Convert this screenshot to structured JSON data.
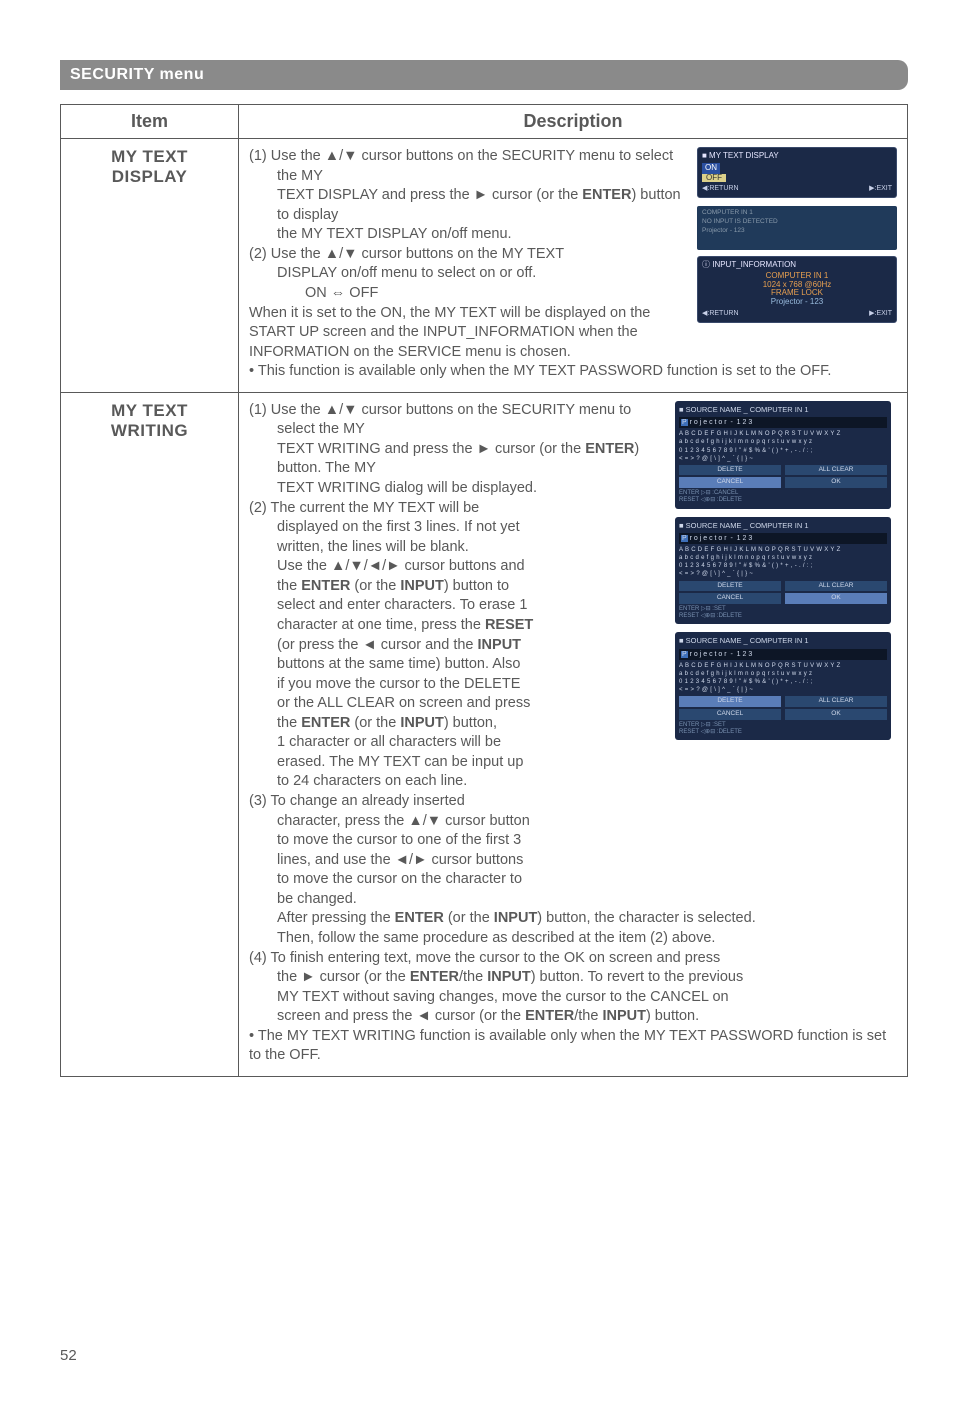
{
  "page_number": "52",
  "menu_header": "SECURITY menu",
  "table": {
    "headers": {
      "item": "Item",
      "description": "Description"
    },
    "rows": [
      {
        "item_line1": "MY TEXT",
        "item_line2": "DISPLAY",
        "desc": {
          "p1a": "(1) Use the ▲/▼ cursor buttons on the SECURITY menu to select the MY",
          "p1b": "TEXT DISPLAY and press the ► cursor (or the ",
          "p1b_bold": "ENTER",
          "p1c": ") button to display",
          "p1d": "the MY TEXT DISPLAY on/off menu.",
          "p2a": "(2) Use the ▲/▼ cursor buttons on the MY TEXT",
          "p2b": "DISPLAY on/off menu to select on or off.",
          "toggle": "ON ⇔ OFF",
          "p3": "When it is set to the ON, the MY TEXT will be displayed on the START UP screen and the INPUT_INFORMATION when the INFORMATION on the SERVICE menu is chosen.",
          "note1": "• This function is available only when the MY TEXT PASSWORD function is set to the OFF.",
          "osd1": {
            "title": "■ MY TEXT DISPLAY",
            "on": "ON",
            "off": "OFF",
            "ret": "◀:RETURN",
            "exit": "▶:EXIT"
          },
          "osd2": {
            "l1": "COMPUTER IN 1",
            "l2": "NO INPUT IS DETECTED",
            "l3": "Projector - 123"
          },
          "osd3": {
            "title": "ⓘ INPUT_INFORMATION",
            "l1": "COMPUTER IN 1",
            "l2": "1024 x 768 @60Hz",
            "l3": "FRAME LOCK",
            "l4": "Projector - 123",
            "ret": "◀:RETURN",
            "exit": "▶:EXIT"
          }
        }
      },
      {
        "item_line1": "MY TEXT",
        "item_line2": "WRITING",
        "desc": {
          "p1a": "(1) Use the ▲/▼ cursor buttons on the SECURITY menu to select the MY",
          "p1b": "TEXT WRITING and press the ► cursor (or the ",
          "p1b_bold": "ENTER",
          "p1c": ") button. The MY",
          "p1d": "TEXT WRITING dialog will be displayed.",
          "p2a": "(2) The current the MY TEXT will be",
          "p2b": "displayed on the first 3 lines. If not yet",
          "p2c": "written, the lines will be blank.",
          "p2d": "Use the ▲/▼/◄/► cursor buttons and",
          "p2e_a": "the ",
          "p2e_b1": "ENTER",
          "p2e_c": " (or the ",
          "p2e_b2": "INPUT",
          "p2e_d": ") button to",
          "p2f": "select and enter characters. To erase 1",
          "p2g_a": "character at one time, press the ",
          "p2g_b": "RESET",
          "p2h_a": "(or press the ◄ cursor and the ",
          "p2h_b": "INPUT",
          "p2i": "buttons at the same time) button. Also",
          "p2j": "if you move the cursor to the DELETE",
          "p2k": "or the ALL CLEAR on screen and press",
          "p2l_a": "the ",
          "p2l_b1": "ENTER",
          "p2l_c": " (or the ",
          "p2l_b2": "INPUT",
          "p2l_d": ") button,",
          "p2m": "1 character or all characters will be",
          "p2n": "erased. The MY TEXT can be input up",
          "p2o": "to 24 characters on each line.",
          "p3a": "(3) To change an already inserted",
          "p3b": "character, press the ▲/▼ cursor button",
          "p3c": "to move the cursor to one of the first 3",
          "p3d": "lines, and use the ◄/► cursor buttons",
          "p3e": "to move the cursor on the character to",
          "p3f": "be changed.",
          "p3g_a": "After pressing the ",
          "p3g_b1": "ENTER",
          "p3g_c": " (or the ",
          "p3g_b2": "INPUT",
          "p3g_d": ") button, the character is selected.",
          "p3h": "Then, follow the same procedure as described at the item (2) above.",
          "p4a": "(4) To finish entering text, move the cursor to the OK on screen and press",
          "p4b_a": "the ► cursor (or the ",
          "p4b_b1": "ENTER",
          "p4b_c": "/the ",
          "p4b_b2": "INPUT",
          "p4b_d": ") button. To revert to the previous",
          "p4c": "MY TEXT without saving changes, move the cursor to the CANCEL on",
          "p4d_a": "screen and press the ◄ cursor (or the ",
          "p4d_b1": "ENTER",
          "p4d_c": "/the ",
          "p4d_b2": "INPUT",
          "p4d_d": ") button.",
          "note1": "• The MY TEXT WRITING function is available only when the MY TEXT PASSWORD function is set to the OFF.",
          "kbd": {
            "hdr": "■ SOURCE NAME _ COMPUTER IN 1",
            "input": "P r o j e c t o r   -   1 2 3",
            "row1": "A B C D E F G H I J K L M N O P Q R S T U V W X Y Z",
            "row2": "a b c d e f g h i j k l m n o p q r s t u v w x y z",
            "row3": "0 1 2 3 4 5 6 7 8 9 ! \" # $ % & ' ( ) * + , - . / : ;",
            "row4": "< = > ? @ [ \\ ] ^ _ ` { | } ~",
            "del": "DELETE",
            "all": "ALL CLEAR",
            "cancel": "CANCEL",
            "ok": "OK",
            "f1": "ENTER ▷⊟ :CANCEL",
            "f2": "RESET ◁⊕⊟ :DELETE",
            "f3": "ENTER ▷⊟ :SET",
            "f4": "RESET ◁⊕⊟ :DELETE"
          }
        }
      }
    ]
  }
}
